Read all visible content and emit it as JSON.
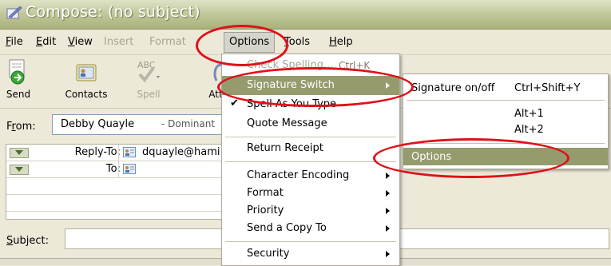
{
  "window": {
    "title": "Compose: (no subject)"
  },
  "menubar": {
    "file": "File",
    "edit": "Edit",
    "view": "View",
    "insert": "Insert",
    "format": "Format",
    "options": "Options",
    "tools": "Tools",
    "help": "Help"
  },
  "toolbar": {
    "send": "Send",
    "contacts": "Contacts",
    "spell": "Spell",
    "attach": "Att"
  },
  "compose": {
    "from_label": "From:",
    "from_name": "Debby Quayle",
    "from_suffix": "- Dominant",
    "reply_to_label": "Reply-To:",
    "reply_to_value": "dquayle@hami",
    "to_label": "To:",
    "subject_label": "Subject:",
    "subject_value": ""
  },
  "options_menu": {
    "items": [
      {
        "label": "Check Spelling...",
        "shortcut": "Ctrl+K"
      },
      {
        "label": "Signature Switch"
      },
      {
        "label": "Spell As You Type"
      },
      {
        "label": "Quote Message"
      },
      {
        "label": "Return Receipt"
      },
      {
        "label": "Character Encoding"
      },
      {
        "label": "Format"
      },
      {
        "label": "Priority"
      },
      {
        "label": "Send a Copy To"
      },
      {
        "label": "Security"
      }
    ]
  },
  "signature_submenu": {
    "items": [
      {
        "label": "Signature on/off",
        "shortcut": "Ctrl+Shift+Y"
      },
      {
        "label": "",
        "shortcut": "Alt+1"
      },
      {
        "label": "",
        "shortcut": "Alt+2"
      },
      {
        "label": "Options"
      }
    ]
  },
  "colors": {
    "highlight": "#969b6e",
    "annotation": "#e0101a",
    "titlebar": "#c3c99d"
  }
}
